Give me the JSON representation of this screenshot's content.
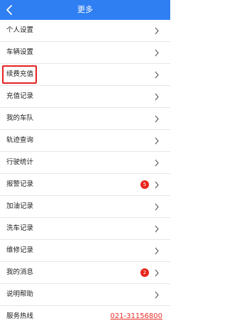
{
  "header": {
    "title": "更多",
    "back_icon": "chevron-left-icon"
  },
  "colors": {
    "header": "#2f7ff3",
    "badge": "#e8251c",
    "highlight": "#e52222",
    "hotline": "#e8302a"
  },
  "items": [
    {
      "label": "个人设置"
    },
    {
      "label": "车辆设置"
    },
    {
      "label": "续费充值",
      "highlighted": true
    },
    {
      "label": "充值记录"
    },
    {
      "label": "我的车队"
    },
    {
      "label": "轨迹查询"
    },
    {
      "label": "行驶统计"
    },
    {
      "label": "报警记录",
      "badge": "5"
    },
    {
      "label": "加油记录"
    },
    {
      "label": "洗车记录"
    },
    {
      "label": "维修记录"
    },
    {
      "label": "我的消息",
      "badge": "2"
    },
    {
      "label": "说明帮助"
    }
  ],
  "hotline": {
    "label": "服务热线",
    "number": "021-31156800"
  }
}
